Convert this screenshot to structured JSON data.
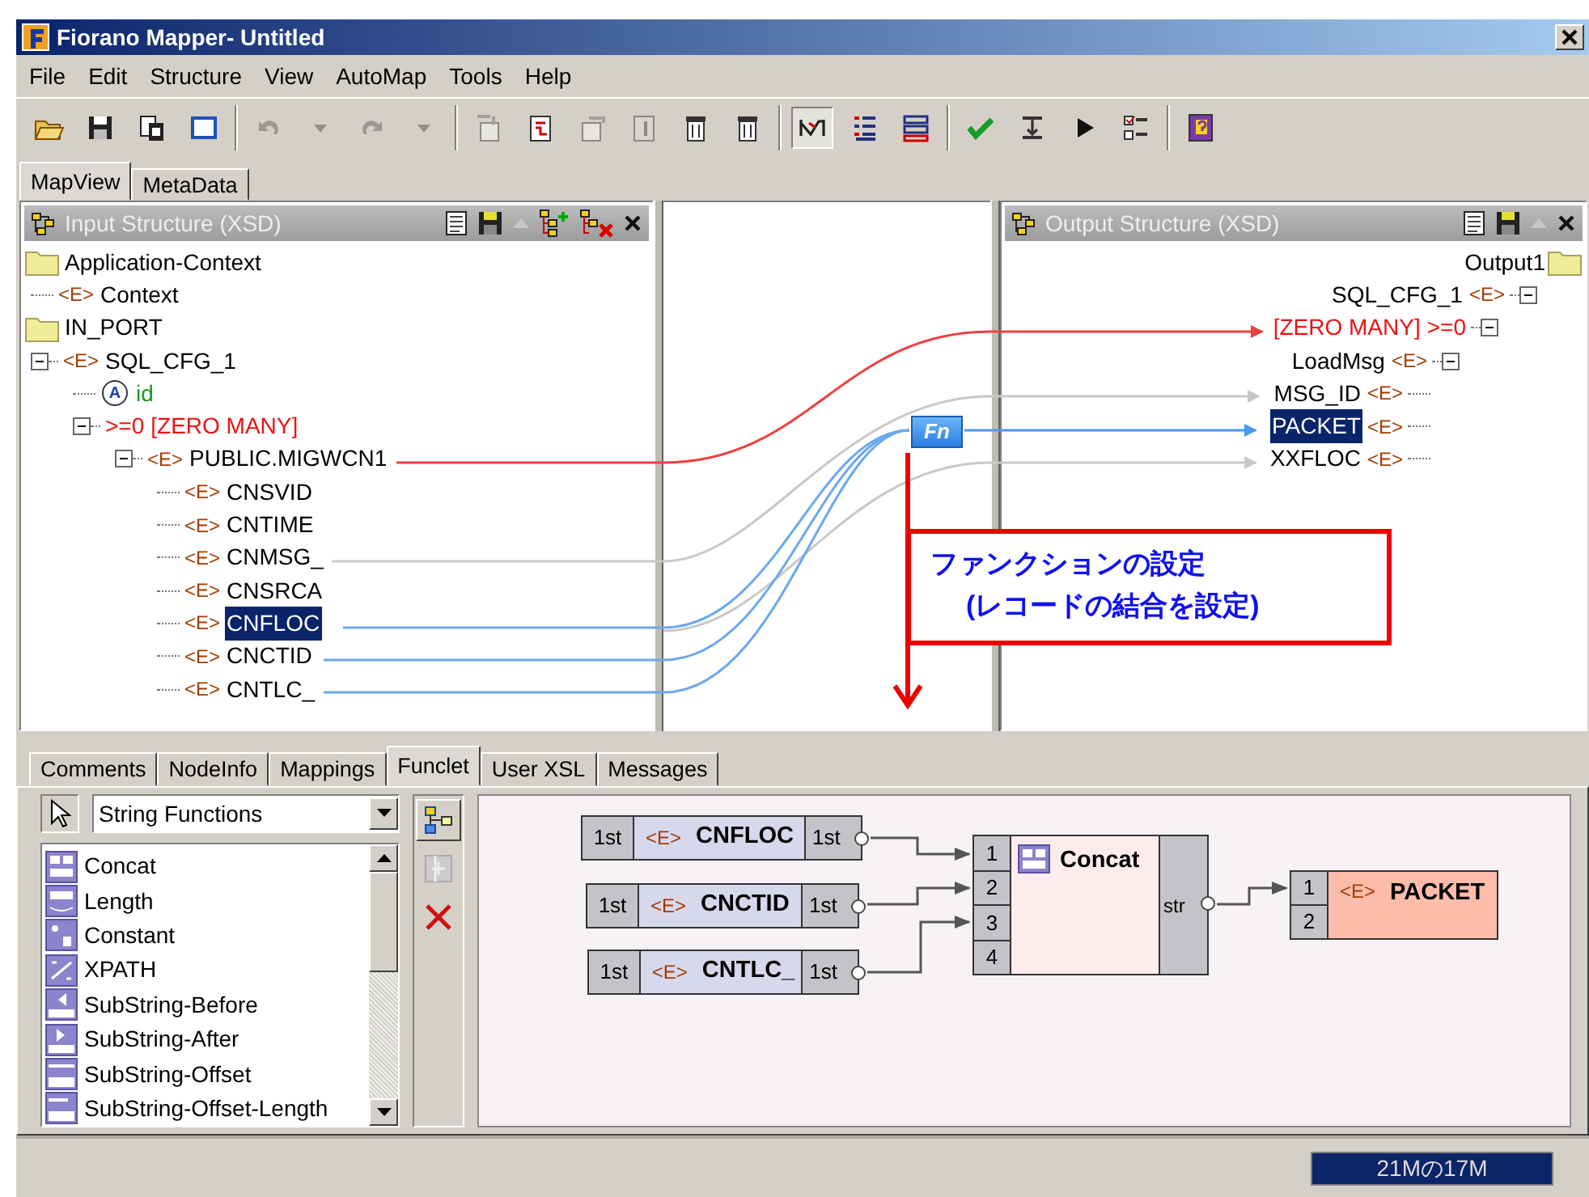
{
  "window": {
    "title": "Fiorano Mapper- Untitled"
  },
  "menu": [
    "File",
    "Edit",
    "Structure",
    "View",
    "AutoMap",
    "Tools",
    "Help"
  ],
  "toolbar": [
    {
      "kind": "open",
      "disabled": false,
      "pressed": false
    },
    {
      "kind": "save",
      "disabled": false,
      "pressed": false
    },
    {
      "kind": "copy",
      "disabled": false,
      "pressed": false
    },
    {
      "kind": "window",
      "disabled": false,
      "pressed": false
    },
    {
      "kind": "separator"
    },
    {
      "kind": "undo",
      "disabled": true,
      "pressed": false
    },
    {
      "kind": "caret",
      "disabled": true,
      "pressed": false
    },
    {
      "kind": "redo",
      "disabled": true,
      "pressed": false
    },
    {
      "kind": "caret",
      "disabled": true,
      "pressed": false
    },
    {
      "kind": "separator"
    },
    {
      "kind": "import",
      "disabled": true,
      "pressed": false
    },
    {
      "kind": "map",
      "disabled": false,
      "pressed": false
    },
    {
      "kind": "export",
      "disabled": true,
      "pressed": false
    },
    {
      "kind": "document",
      "disabled": true,
      "pressed": false
    },
    {
      "kind": "trash",
      "disabled": false,
      "pressed": false
    },
    {
      "kind": "trash",
      "disabled": false,
      "pressed": false
    },
    {
      "kind": "separator"
    },
    {
      "kind": "lines",
      "disabled": false,
      "pressed": true
    },
    {
      "kind": "list",
      "disabled": false,
      "pressed": false
    },
    {
      "kind": "grid",
      "disabled": false,
      "pressed": false
    },
    {
      "kind": "separator"
    },
    {
      "kind": "check",
      "disabled": false,
      "pressed": false
    },
    {
      "kind": "step",
      "disabled": false,
      "pressed": false
    },
    {
      "kind": "play",
      "disabled": false,
      "pressed": false
    },
    {
      "kind": "checklist",
      "disabled": false,
      "pressed": false
    },
    {
      "kind": "separator"
    },
    {
      "kind": "book",
      "disabled": false,
      "pressed": false
    }
  ],
  "view_tabs": [
    {
      "label": "MapView",
      "selected": true
    },
    {
      "label": "MetaData",
      "selected": false
    }
  ],
  "input_structure": {
    "title": "Input Structure (XSD)",
    "tree": [
      {
        "kind": "folder",
        "label": "Application-Context",
        "selected": false,
        "children": [
          {
            "kind": "element",
            "tag": "<E>",
            "label": "Context",
            "selected": false
          }
        ]
      },
      {
        "kind": "folder",
        "label": "IN_PORT",
        "selected": false,
        "children": [
          {
            "kind": "element",
            "tag": "<E>",
            "label": "SQL_CFG_1",
            "expanded": true,
            "selected": false,
            "children": [
              {
                "kind": "attribute",
                "tag": "A",
                "label": "id",
                "selected": false
              },
              {
                "kind": "repeat",
                "quantifier": ">=0",
                "label": "[ZERO MANY]",
                "expanded": true,
                "selected": false,
                "children": [
                  {
                    "kind": "element",
                    "tag": "<E>",
                    "label": "PUBLIC.MIGWCN1",
                    "expanded": true,
                    "selected": false,
                    "children": [
                      {
                        "kind": "element",
                        "tag": "<E>",
                        "label": "CNSVID",
                        "selected": false
                      },
                      {
                        "kind": "element",
                        "tag": "<E>",
                        "label": "CNTIME",
                        "selected": false
                      },
                      {
                        "kind": "element",
                        "tag": "<E>",
                        "label": "CNMSG_",
                        "selected": false
                      },
                      {
                        "kind": "element",
                        "tag": "<E>",
                        "label": "CNSRCA",
                        "selected": false
                      },
                      {
                        "kind": "element",
                        "tag": "<E>",
                        "label": "CNFLOC",
                        "selected": true
                      },
                      {
                        "kind": "element",
                        "tag": "<E>",
                        "label": "CNCTID",
                        "selected": false
                      },
                      {
                        "kind": "element",
                        "tag": "<E>",
                        "label": "CNTLC_",
                        "selected": false
                      }
                    ]
                  }
                ]
              }
            ]
          }
        ]
      }
    ]
  },
  "mapping_area": {
    "function_badge": "Fn",
    "annotation": [
      "ファンクションの設定",
      "(レコードの結合を設定)"
    ]
  },
  "output_structure": {
    "title": "Output Structure (XSD)",
    "tree": [
      {
        "kind": "folder",
        "label": "Output1",
        "selected": false,
        "children": [
          {
            "kind": "element",
            "tag": "<E>",
            "label": "SQL_CFG_1",
            "expanded": true,
            "selected": false,
            "children": [
              {
                "kind": "repeat",
                "quantifier": ">=0",
                "label": "[ZERO MANY]",
                "expanded": true,
                "selected": false,
                "children": [
                  {
                    "kind": "element",
                    "tag": "<E>",
                    "label": "LoadMsg",
                    "expanded": true,
                    "selected": false,
                    "children": [
                      {
                        "kind": "element",
                        "tag": "<E>",
                        "label": "MSG_ID",
                        "selected": false
                      },
                      {
                        "kind": "element",
                        "tag": "<E>",
                        "label": "PACKET",
                        "selected": true
                      },
                      {
                        "kind": "element",
                        "tag": "<E>",
                        "label": "XXFLOC",
                        "selected": false
                      }
                    ]
                  }
                ]
              }
            ]
          }
        ]
      }
    ]
  },
  "detail_tabs": [
    {
      "label": "Comments",
      "selected": false
    },
    {
      "label": "NodeInfo",
      "selected": false
    },
    {
      "label": "Mappings",
      "selected": false
    },
    {
      "label": "Funclet",
      "selected": true
    },
    {
      "label": "User XSL",
      "selected": false
    },
    {
      "label": "Messages",
      "selected": false
    }
  ],
  "funclet": {
    "category": "String Functions",
    "functions": [
      "Concat",
      "Length",
      "Constant",
      "XPATH",
      "SubString-Before",
      "SubString-After",
      "SubString-Offset",
      "SubString-Offset-Length"
    ],
    "sources": [
      {
        "in_port": "1st",
        "tag": "<E>",
        "name": "CNFLOC",
        "out_port": "1st"
      },
      {
        "in_port": "1st",
        "tag": "<E>",
        "name": "CNCTID",
        "out_port": "1st"
      },
      {
        "in_port": "1st",
        "tag": "<E>",
        "name": "CNTLC_",
        "out_port": "1st"
      }
    ],
    "function": {
      "name": "Concat",
      "ports": [
        "1",
        "2",
        "3",
        "4"
      ],
      "output": "str"
    },
    "target": {
      "ports": [
        "1",
        "2"
      ],
      "tag": "<E>",
      "name": "PACKET"
    }
  },
  "status_bar": {
    "memory": "21Mの17M"
  }
}
